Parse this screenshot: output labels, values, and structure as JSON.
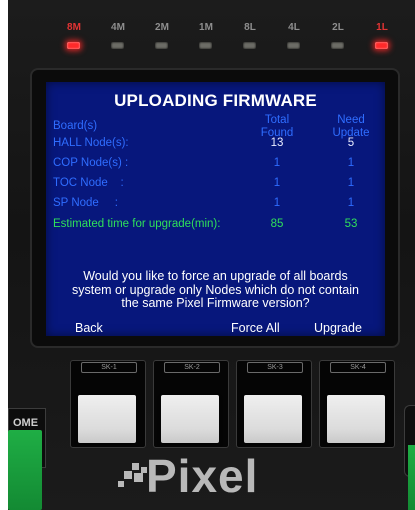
{
  "leds": [
    {
      "label": "8M",
      "on": true
    },
    {
      "label": "4M",
      "on": false
    },
    {
      "label": "2M",
      "on": false
    },
    {
      "label": "1M",
      "on": false
    },
    {
      "label": "8L",
      "on": false
    },
    {
      "label": "4L",
      "on": false
    },
    {
      "label": "2L",
      "on": false
    },
    {
      "label": "1L",
      "on": true
    }
  ],
  "screen": {
    "title": "UPLOADING FIRMWARE",
    "headers": {
      "board": "Board(s)",
      "total_line1": "Total",
      "total_line2": "Found",
      "need_line1": "Need",
      "need_line2": "Update"
    },
    "rows": [
      {
        "label": "HALL Node(s):",
        "total": "13",
        "need": "5"
      },
      {
        "label": "COP Node(s) :",
        "total": "1",
        "need": "1"
      },
      {
        "label": "TOC Node    :",
        "total": "1",
        "need": "1"
      },
      {
        "label": "SP Node     :",
        "total": "1",
        "need": "1"
      }
    ],
    "estimate": {
      "label": "Estimated time for upgrade(min):",
      "total": "85",
      "need": "53"
    },
    "message": [
      "Would you like to force an upgrade of all boards",
      "system or upgrade only Nodes which do not contain",
      "the same Pixel Firmware version?"
    ],
    "softkey_labels": {
      "back": "Back",
      "force_all": "Force All",
      "upgrade": "Upgrade"
    }
  },
  "soft_keys": [
    {
      "tab": "SK-1"
    },
    {
      "tab": "SK-2"
    },
    {
      "tab": "SK-3"
    },
    {
      "tab": "SK-4"
    }
  ],
  "side_left_label": "OME",
  "brand": "Pixel",
  "colors": {
    "screen_bg": "#07177c",
    "label_blue": "#2f6dff",
    "estimate_green": "#2fe05a",
    "led_on": "#ff2a2a"
  }
}
